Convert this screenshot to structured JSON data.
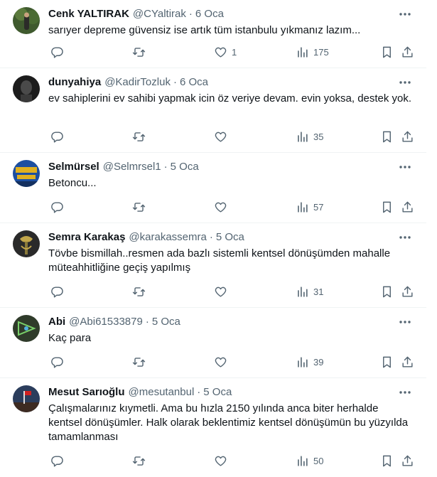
{
  "tweets": [
    {
      "name": "Cenk YALTIRAK",
      "handle": "@CYaltirak",
      "sep": "·",
      "time": "6 Oca",
      "text": "sarıyer depreme güvensiz ise artık tüm istanbulu yıkmanız lazım...",
      "likes": "1",
      "views": "175",
      "avatar_color": "#3f5a2e"
    },
    {
      "name": "dunyahiya",
      "handle": "@KadirTozluk",
      "sep": "·",
      "time": "6 Oca",
      "text": "ev sahiplerini ev sahibi yapmak icin öz veriye devam. evin yoksa, destek yok.",
      "likes": "",
      "views": "35",
      "avatar_color": "#1c1c1c"
    },
    {
      "name": "Selmürsel",
      "handle": "@Selmrsel1",
      "sep": "·",
      "time": "5 Oca",
      "text": "Betoncu...",
      "likes": "",
      "views": "57",
      "avatar_color": "#1d4fa0"
    },
    {
      "name": "Semra Karakaş",
      "handle": "@karakassemra",
      "sep": "·",
      "time": "5 Oca",
      "text": "Tövbe bismillah..resmen ada bazlı sistemli kentsel dönüşümden mahalle müteahhitliğine geçiş yapılmış",
      "likes": "",
      "views": "31",
      "avatar_color": "#2a2a2a"
    },
    {
      "name": "Abi",
      "handle": "@Abi61533879",
      "sep": "·",
      "time": "5 Oca",
      "text": "Kaç para",
      "likes": "",
      "views": "39",
      "avatar_color": "#2f3b2a"
    },
    {
      "name": "Mesut Sarıoğlu",
      "handle": "@mesutanbul",
      "sep": "·",
      "time": "5 Oca",
      "text": "Çalışmalarınız kıymetli. Ama bu hızla 2150 yılında anca biter herhalde kentsel dönüşümler. Halk olarak beklentimiz kentsel dönüşümün bu yüzyılda tamamlanması",
      "likes": "",
      "views": "50",
      "avatar_color": "#2b3d5c"
    }
  ],
  "icons": [
    "more-icon",
    "reply-icon",
    "retweet-icon",
    "like-icon",
    "views-icon",
    "bookmark-icon",
    "share-icon"
  ],
  "colors": {
    "text": "#0f1419",
    "secondary": "#536471",
    "divider": "#eff3f4"
  }
}
